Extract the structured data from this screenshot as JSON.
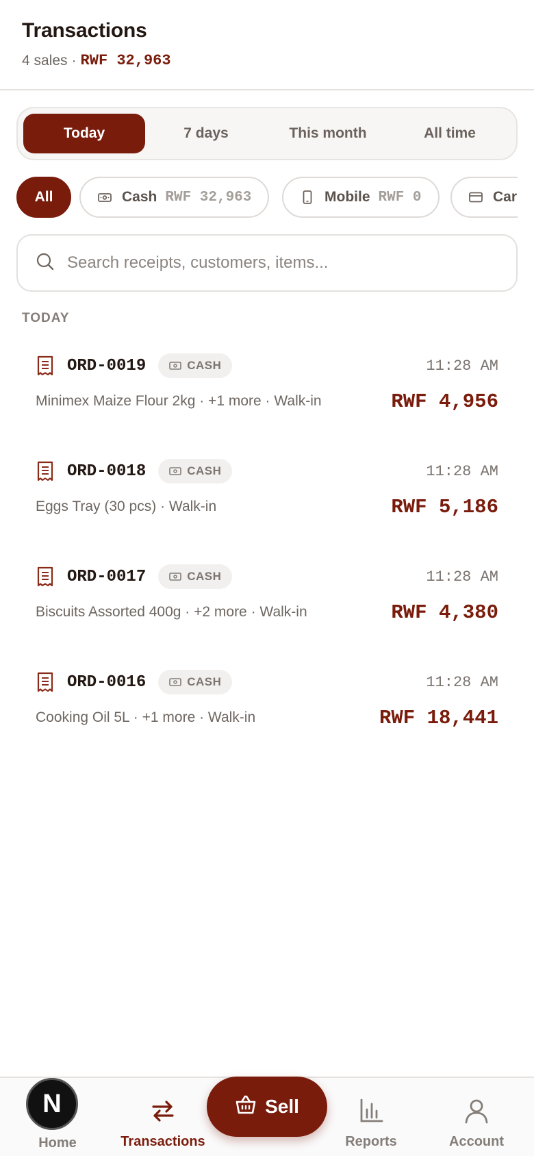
{
  "header": {
    "title": "Transactions",
    "sales_count": "4 sales",
    "separator": "·",
    "total": "RWF 32,963"
  },
  "period_tabs": [
    "Today",
    "7 days",
    "This month",
    "All time"
  ],
  "period_selected": "Today",
  "payment_filters": {
    "all": "All",
    "cash_label": "Cash",
    "cash_value": "RWF 32,963",
    "mobile_label": "Mobile",
    "mobile_value": "RWF 0",
    "card_label": "Car"
  },
  "search": {
    "placeholder": "Search receipts, customers, items..."
  },
  "section_label": "TODAY",
  "transactions": [
    {
      "id": "ORD-0019",
      "method": "CASH",
      "time": "11:28 AM",
      "description": "Minimex Maize Flour 2kg · +1 more · Walk-in",
      "total": "RWF 4,956"
    },
    {
      "id": "ORD-0018",
      "method": "CASH",
      "time": "11:28 AM",
      "description": "Eggs Tray (30 pcs) · Walk-in",
      "total": "RWF 5,186"
    },
    {
      "id": "ORD-0017",
      "method": "CASH",
      "time": "11:28 AM",
      "description": "Biscuits Assorted 400g · +2 more · Walk-in",
      "total": "RWF 4,380"
    },
    {
      "id": "ORD-0016",
      "method": "CASH",
      "time": "11:28 AM",
      "description": "Cooking Oil 5L · +1 more · Walk-in",
      "total": "RWF 18,441"
    }
  ],
  "nav": {
    "home": "Home",
    "transactions": "Transactions",
    "sell": "Sell",
    "reports": "Reports",
    "account": "Account",
    "avatar_letter": "N"
  },
  "colors": {
    "accent": "#7a1c0c",
    "muted": "#847d78",
    "border": "#e4e1de"
  },
  "icons": [
    "cash-icon",
    "phone-icon",
    "card-icon",
    "search-icon",
    "receipt-icon",
    "swap-arrows-icon",
    "basket-icon",
    "bar-chart-icon",
    "user-icon"
  ]
}
